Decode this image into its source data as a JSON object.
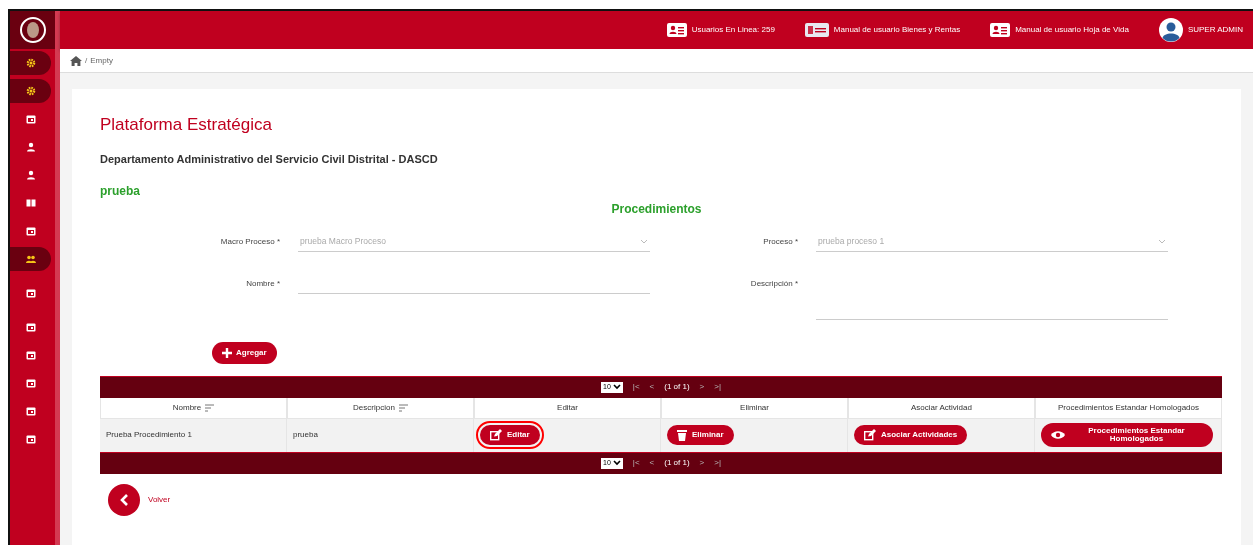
{
  "sidebar": {
    "items": [
      {
        "kind": "gear",
        "selected": true
      },
      {
        "kind": "gear",
        "selected": true
      },
      {
        "kind": "calendar",
        "selected": false
      },
      {
        "kind": "person",
        "selected": false
      },
      {
        "kind": "person",
        "selected": false
      },
      {
        "kind": "book",
        "selected": false
      },
      {
        "kind": "calendar",
        "selected": false
      },
      {
        "kind": "people",
        "selected": true
      },
      {
        "kind": "calendar",
        "selected": false
      },
      {
        "kind": "calendar",
        "selected": false
      },
      {
        "kind": "calendar",
        "selected": false
      },
      {
        "kind": "calendar",
        "selected": false
      },
      {
        "kind": "calendar",
        "selected": false
      },
      {
        "kind": "calendar",
        "selected": false
      }
    ]
  },
  "topbar": {
    "links": [
      {
        "kind": "card",
        "label": "Usuarios En Linea: 259"
      },
      {
        "kind": "money",
        "label": "Manual de usuario Bienes y Rentas"
      },
      {
        "kind": "card",
        "label": "Manual de usuario Hoja de Vida"
      },
      {
        "kind": "user",
        "label": "SUPER ADMIN"
      }
    ]
  },
  "breadcrumb": {
    "separator": "/",
    "current": "Empty"
  },
  "page": {
    "title": "Plataforma Estratégica",
    "entity": "Departamento Administrativo del Servicio Civil Distrital - DASCD",
    "subtitle": "prueba",
    "section": "Procedimientos"
  },
  "form": {
    "fields": [
      {
        "label": "Macro Proceso *",
        "kind": "select",
        "value": "prueba Macro Proceso"
      },
      {
        "label": "Proceso *",
        "kind": "select",
        "value": "prueba proceso 1"
      },
      {
        "label": "Nombre *",
        "kind": "text"
      },
      {
        "label": "Descripción *",
        "kind": "textarea"
      }
    ],
    "add_button": "Agregar"
  },
  "table": {
    "paginators": [
      {
        "page_size": "10",
        "first": "|<",
        "prev": "<",
        "report": "(1 of 1)",
        "next": ">",
        "last": ">|"
      },
      {
        "page_size": "10",
        "first": "|<",
        "prev": "<",
        "report": "(1 of 1)",
        "next": ">",
        "last": ">|"
      }
    ],
    "columns": [
      {
        "label": "Nombre",
        "sortable": true
      },
      {
        "label": "Descripcion",
        "sortable": true
      },
      {
        "label": "Editar",
        "sortable": false
      },
      {
        "label": "Eliminar",
        "sortable": false
      },
      {
        "label": "Asociar Actividad",
        "sortable": false
      },
      {
        "label": "Procedimientos Estandar Homologados",
        "sortable": false
      }
    ],
    "rows": [
      {
        "cells": [
          {
            "kind": "text",
            "text": "Prueba Procedimiento 1"
          },
          {
            "kind": "text",
            "text": "prueba"
          },
          {
            "kind": "edit",
            "text": "Editar",
            "highlighted": true
          },
          {
            "kind": "trash",
            "text": "Eliminar",
            "highlighted": false
          },
          {
            "kind": "edit",
            "text": "Asociar Actividades",
            "highlighted": false
          },
          {
            "kind": "view",
            "text": "Procedimientos Estandar Homologados",
            "highlighted": false
          }
        ]
      }
    ]
  },
  "back_button": "Volver"
}
